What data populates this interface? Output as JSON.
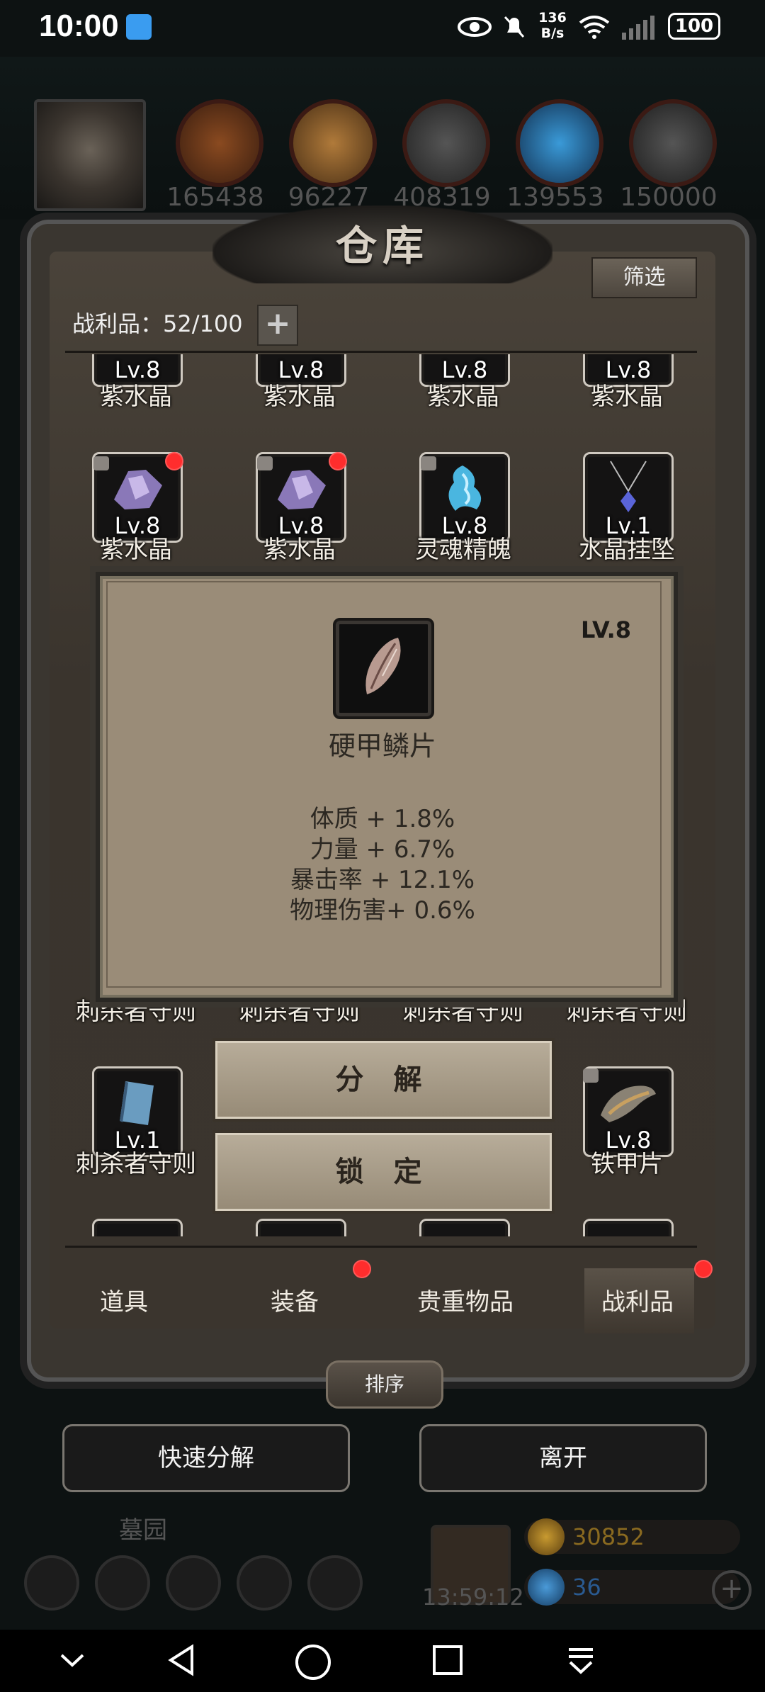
{
  "status_bar": {
    "time": "10:00",
    "net_speed_value": "136",
    "net_speed_unit": "B/s",
    "battery": "100"
  },
  "resources": [
    "165438",
    "96227",
    "408319",
    "139553",
    "150000"
  ],
  "warehouse": {
    "title": "仓库",
    "filter_label": "筛选",
    "spoils_label": "战利品：52/100",
    "plus": "+",
    "rows": [
      {
        "items": [
          {
            "lv": "Lv.8",
            "name": "紫水晶"
          },
          {
            "lv": "Lv.8",
            "name": "紫水晶"
          },
          {
            "lv": "Lv.8",
            "name": "紫水晶"
          },
          {
            "lv": "Lv.8",
            "name": "紫水晶"
          }
        ]
      },
      {
        "items": [
          {
            "lv": "Lv.8",
            "name": "紫水晶"
          },
          {
            "lv": "Lv.8",
            "name": "紫水晶"
          },
          {
            "lv": "Lv.8",
            "name": "灵魂精魄"
          },
          {
            "lv": "Lv.1",
            "name": "水晶挂坠"
          }
        ]
      },
      {
        "items": [
          {
            "name": "刺杀者守则"
          },
          {
            "name": "刺杀者守则"
          },
          {
            "name": "刺杀者守则"
          },
          {
            "name": "刺杀者守则"
          }
        ]
      },
      {
        "items": [
          {
            "lv": "Lv.1",
            "name": "刺杀者守则"
          },
          {
            "lv": "Lv.8",
            "name": "铁甲片"
          }
        ]
      }
    ]
  },
  "popup": {
    "level": "LV.8",
    "item_name": "硬甲鳞片",
    "stats": [
      "体质 + 1.8%",
      "力量 + 6.7%",
      "暴击率 + 12.1%",
      "物理伤害+ 0.6%"
    ],
    "decompose_label": "分 解",
    "lock_label": "锁 定"
  },
  "tabs": [
    {
      "label": "道具"
    },
    {
      "label": "装备"
    },
    {
      "label": "贵重物品"
    },
    {
      "label": "战利品"
    }
  ],
  "sort_label": "排序",
  "quick_decompose_label": "快速分解",
  "leave_label": "离开",
  "bottom": {
    "graveyard": "墓园",
    "timer": "13:59:12",
    "gold": "30852",
    "gems": "36",
    "plus": "+"
  },
  "colors": {
    "red_dot": "#ff2d2d",
    "gold_text": "#c8a040",
    "gem_text": "#3a7fd0"
  }
}
